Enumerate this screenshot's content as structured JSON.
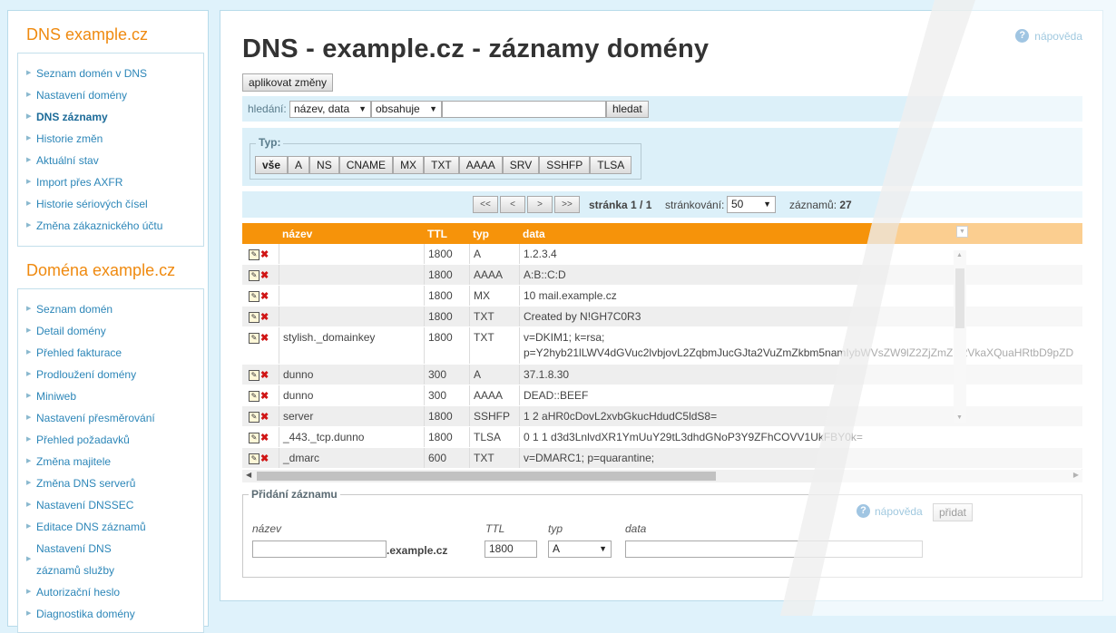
{
  "sidebar": {
    "dns_title": "DNS example.cz",
    "dns_items": [
      {
        "label": "Seznam domén v DNS",
        "active": false
      },
      {
        "label": "Nastavení domény",
        "active": false
      },
      {
        "label": "DNS záznamy",
        "active": true
      },
      {
        "label": "Historie změn",
        "active": false
      },
      {
        "label": "Aktuální stav",
        "active": false
      },
      {
        "label": "Import přes AXFR",
        "active": false
      },
      {
        "label": "Historie sériových čísel",
        "active": false
      },
      {
        "label": "Změna zákaznického účtu",
        "active": false
      }
    ],
    "domain_title": "Doména example.cz",
    "domain_items": [
      {
        "label": "Seznam domén"
      },
      {
        "label": "Detail domény"
      },
      {
        "label": "Přehled fakturace"
      },
      {
        "label": "Prodloužení domény"
      },
      {
        "label": "Miniweb"
      },
      {
        "label": "Nastavení přesměrování"
      },
      {
        "label": "Přehled požadavků"
      },
      {
        "label": "Změna majitele"
      },
      {
        "label": "Změna DNS serverů"
      },
      {
        "label": "Nastavení DNSSEC"
      },
      {
        "label": "Editace DNS záznamů"
      },
      {
        "label": "Nastavení DNS záznamů služby"
      },
      {
        "label": "Autorizační heslo"
      },
      {
        "label": "Diagnostika domény"
      }
    ]
  },
  "main": {
    "title": "DNS - example.cz - záznamy domény",
    "help_label": "nápověda",
    "apply_button": "aplikovat změny"
  },
  "search": {
    "label": "hledání:",
    "field_select": "název, data",
    "mode_select": "obsahuje",
    "value": "",
    "button": "hledat"
  },
  "type_filter": {
    "legend": "Typ:",
    "buttons": [
      "vše",
      "A",
      "NS",
      "CNAME",
      "MX",
      "TXT",
      "AAAA",
      "SRV",
      "SSHFP",
      "TLSA"
    ],
    "active": "vše"
  },
  "pager": {
    "first": "<<",
    "prev": "<",
    "next": ">",
    "last": ">>",
    "page_label": "stránka",
    "page_value": "1 / 1",
    "per_page_label": "stránkování:",
    "per_page_value": "50",
    "count_label": "záznamů:",
    "count_value": "27"
  },
  "table": {
    "headers": {
      "name": "název",
      "ttl": "TTL",
      "type": "typ",
      "data": "data"
    },
    "rows": [
      {
        "name": "",
        "ttl": "1800",
        "type": "A",
        "data": "1.2.3.4"
      },
      {
        "name": "",
        "ttl": "1800",
        "type": "AAAA",
        "data": "A:B::C:D"
      },
      {
        "name": "",
        "ttl": "1800",
        "type": "MX",
        "data": "10 mail.example.cz"
      },
      {
        "name": "",
        "ttl": "1800",
        "type": "TXT",
        "data": "Created by N!GH7C0R3"
      },
      {
        "name": "stylish._domainkey",
        "ttl": "1800",
        "type": "TXT",
        "data": "v=DKIM1; k=rsa;",
        "data2": "p=Y2hyb21lLWV4dGVuc2lvbjovL2ZqbmJucGJta2VuZmZkbm5namIybWVsZW9lZ2ZjZmZlL2VkaXQuaHRtbD9pZD"
      },
      {
        "name": "dunno",
        "ttl": "300",
        "type": "A",
        "data": "37.1.8.30"
      },
      {
        "name": "dunno",
        "ttl": "300",
        "type": "AAAA",
        "data": "DEAD::BEEF"
      },
      {
        "name": "server",
        "ttl": "1800",
        "type": "SSHFP",
        "data": "1 2 aHR0cDovL2xvbGkucHdudC5ldS8="
      },
      {
        "name": "_443._tcp.dunno",
        "ttl": "1800",
        "type": "TLSA",
        "data": "0 1 1 d3d3LnlvdXR1YmUuY29tL3dhdGNoP3Y9ZFhCOVV1UkFBY0k="
      },
      {
        "name": "_dmarc",
        "ttl": "600",
        "type": "TXT",
        "data": "v=DMARC1; p=quarantine;"
      }
    ]
  },
  "add_form": {
    "legend": "Přidání záznamu",
    "help_label": "nápověda",
    "submit": "přidat",
    "name_label": "název",
    "name_value": "",
    "suffix": ".example.cz",
    "ttl_label": "TTL",
    "ttl_value": "1800",
    "type_label": "typ",
    "type_value": "A",
    "data_label": "data",
    "data_value": ""
  },
  "colors": {
    "accent_orange": "#f6930a",
    "link_blue": "#2c86b8",
    "panel_blue": "#dcf0f9"
  }
}
